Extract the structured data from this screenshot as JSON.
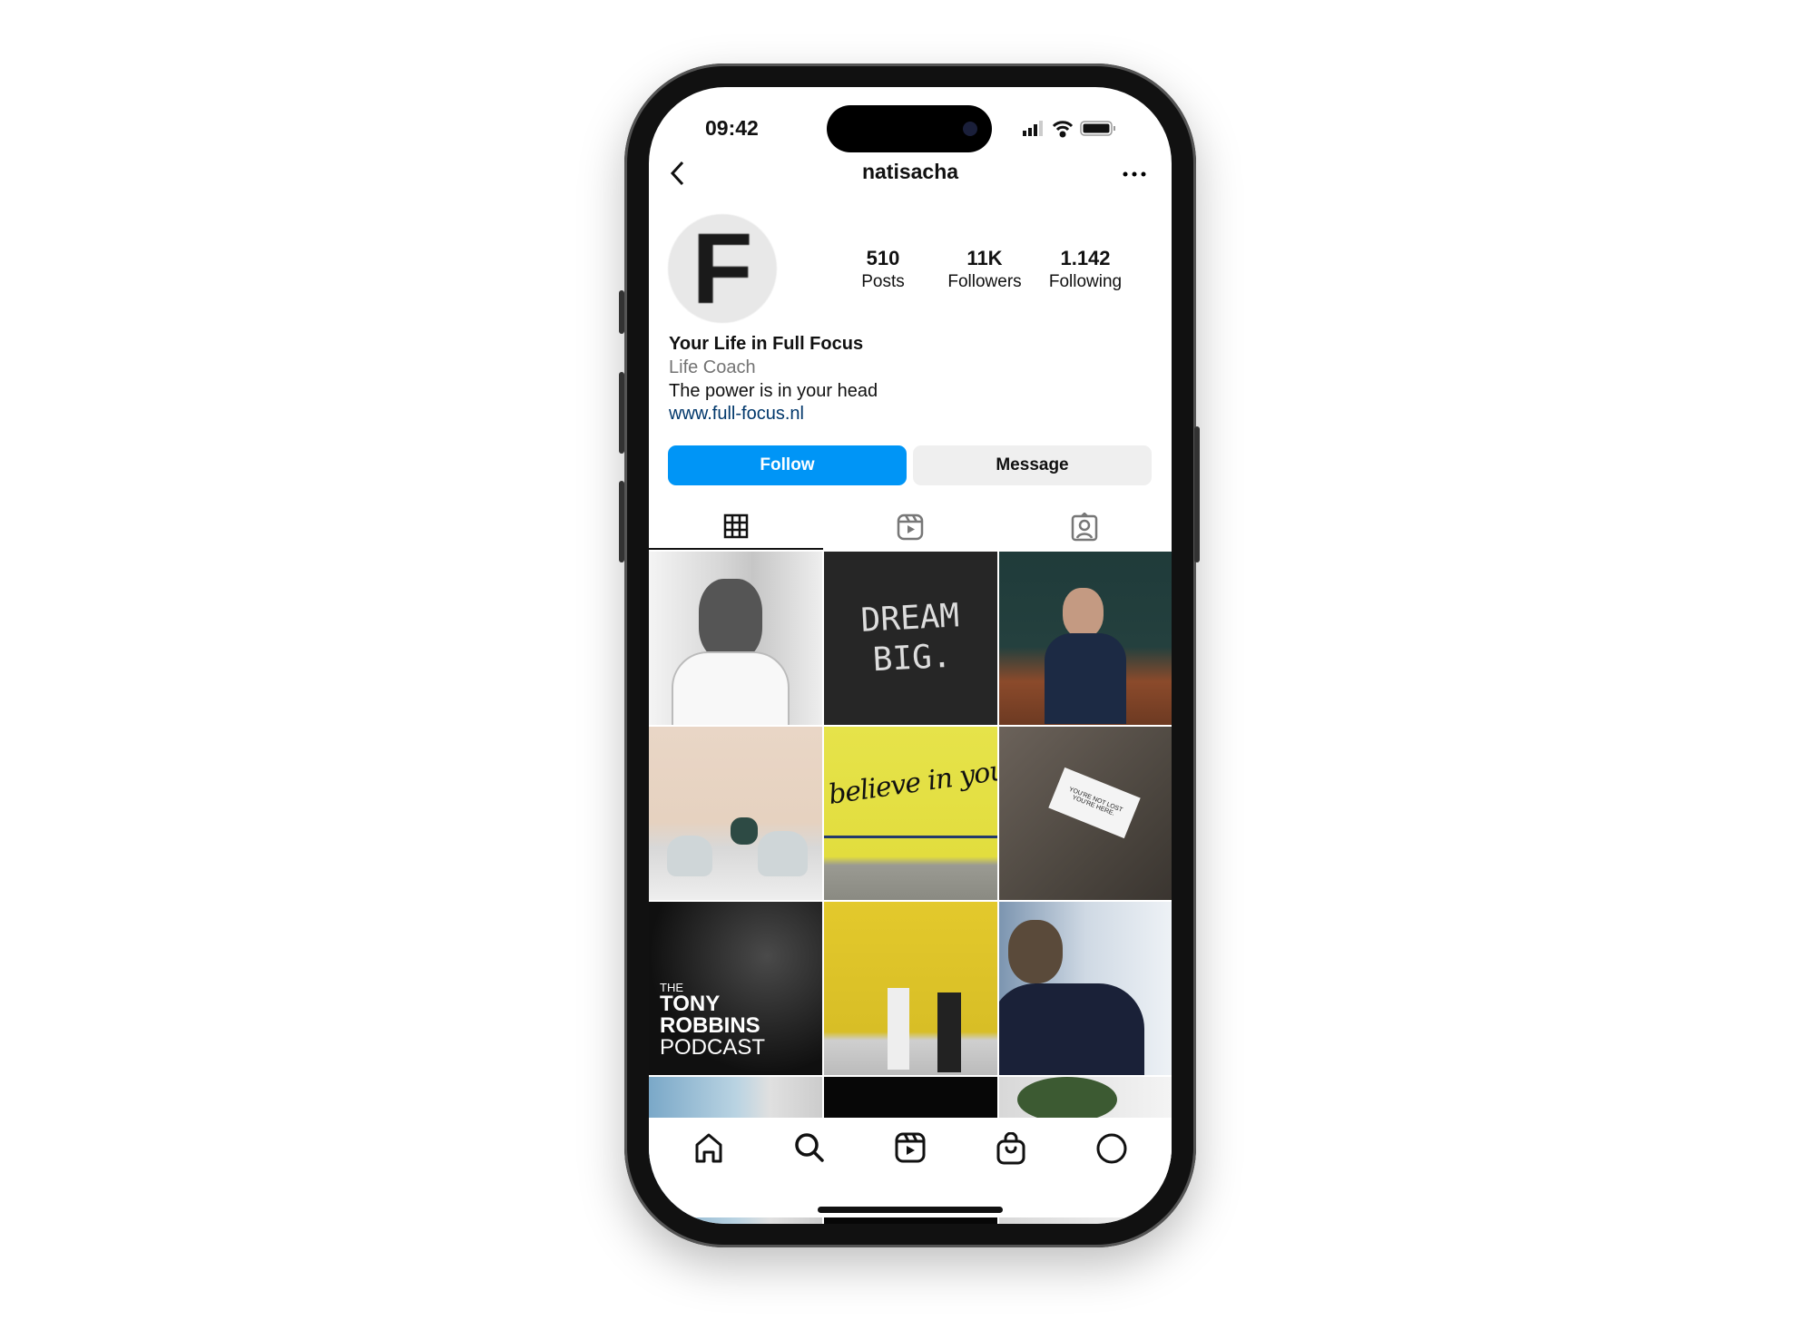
{
  "status_bar": {
    "time": "09:42"
  },
  "header": {
    "username": "natisacha",
    "back_icon": "chevron-left-icon",
    "more_icon": "ellipsis-icon"
  },
  "profile": {
    "avatar_letter": "F",
    "stats": [
      {
        "value": "510",
        "label": "Posts"
      },
      {
        "value": "11K",
        "label": "Followers"
      },
      {
        "value": "1.142",
        "label": "Following"
      }
    ],
    "name": "Your Life in Full Focus",
    "category": "Life Coach",
    "bio": "The power is in your head",
    "link": "www.full-focus.nl"
  },
  "actions": {
    "follow": "Follow",
    "message": "Message"
  },
  "colors": {
    "accent": "#0095f6",
    "link": "#00376b",
    "secondary_button": "#efefef"
  },
  "tabs": [
    {
      "icon": "grid-icon",
      "active": true
    },
    {
      "icon": "reels-icon"
    },
    {
      "icon": "tagged-icon"
    }
  ],
  "posts": [
    {
      "caption": ""
    },
    {
      "caption": "DREAM BIG."
    },
    {
      "caption": ""
    },
    {
      "caption": ""
    },
    {
      "caption": "believe in yourself"
    },
    {
      "caption": "YOU'RE NOT LOST YOU'RE HERE."
    },
    {
      "caption": "THE TONY ROBBINS PODCAST",
      "small": "THE",
      "l1": "TONY",
      "l2": "ROBBINS",
      "l3": "PODCAST"
    },
    {
      "caption": ""
    },
    {
      "caption": ""
    },
    {
      "caption": ""
    },
    {
      "caption": ""
    },
    {
      "caption": ""
    }
  ],
  "bottom_nav": [
    "home-icon",
    "search-icon",
    "reels-icon",
    "shop-icon",
    "profile-icon"
  ]
}
